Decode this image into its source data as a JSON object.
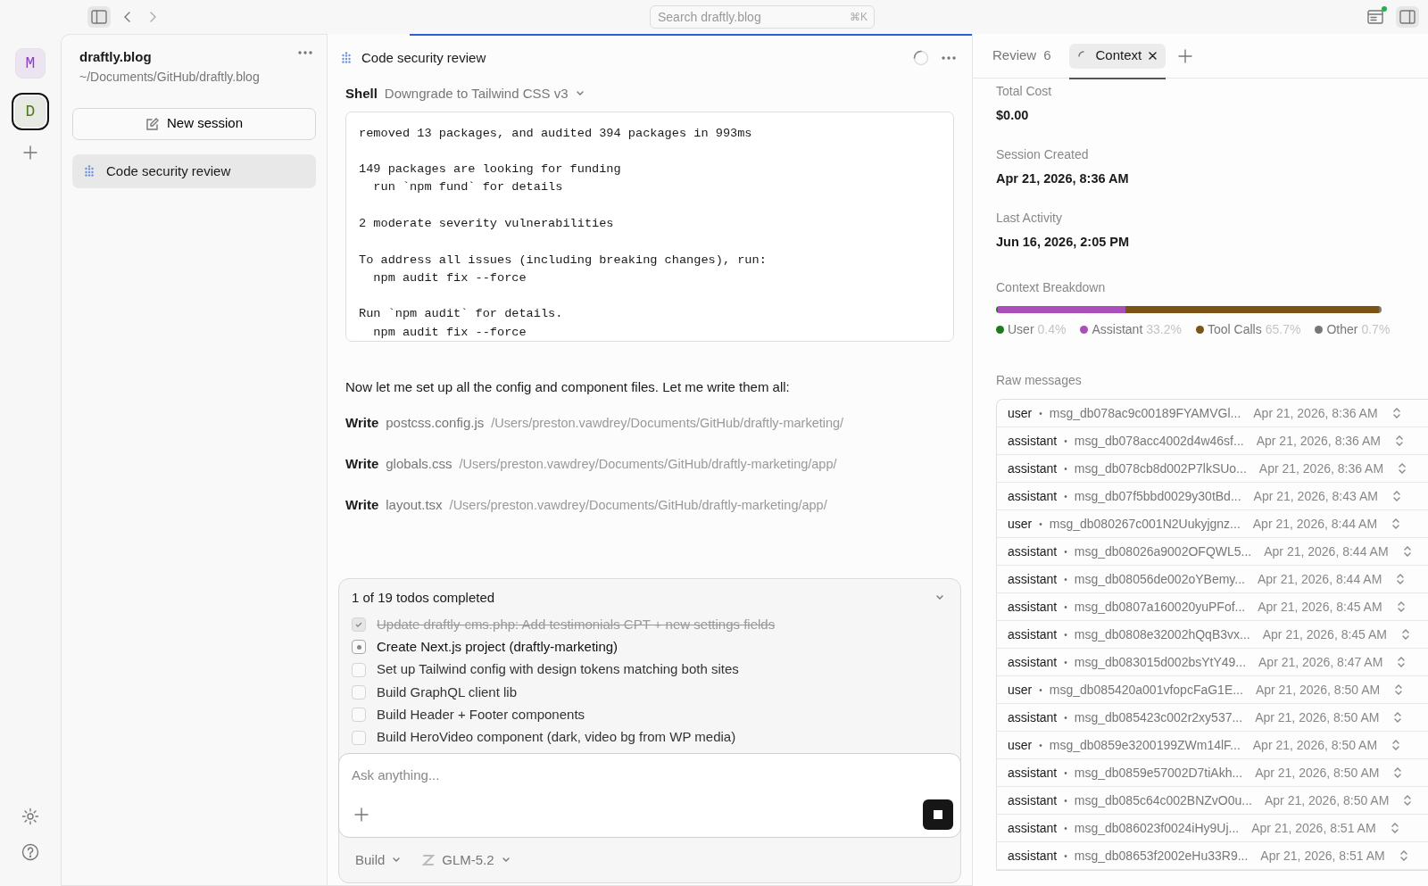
{
  "topbar": {
    "search": {
      "placeholder": "Search draftly.blog",
      "shortcut": "⌘K"
    },
    "notification": true
  },
  "rail": {
    "workspaces": [
      {
        "letter": "M",
        "color": "#8a3fc4",
        "selected": false
      },
      {
        "letter": "D",
        "color": "#4f7a1f",
        "selected": true
      }
    ]
  },
  "sidebar": {
    "project": "draftly.blog",
    "path": "~/Documents/GitHub/draftly.blog",
    "new_session": "New session",
    "sessions": [
      {
        "title": "Code security review",
        "selected": true
      }
    ]
  },
  "session": {
    "title": "Code security review",
    "shell": {
      "label": "Shell",
      "command": "Downgrade to Tailwind CSS v3",
      "output": [
        [
          "removed 13 packages, and audited 394 packages in 993ms"
        ],
        [
          "149 packages are looking for funding",
          "  run `npm fund` for details"
        ],
        [
          "2 moderate severity vulnerabilities"
        ],
        [
          "To address all issues (including breaking changes), run:",
          "  npm audit fix --force"
        ],
        [
          "Run `npm audit` for details.",
          "  npm audit fix --force"
        ]
      ]
    },
    "message": "Now let me set up all the config and component files. Let me write them all:",
    "writes": [
      {
        "label": "Write",
        "file": "postcss.config.js",
        "path": "/Users/preston.vawdrey/Documents/GitHub/draftly-marketing/"
      },
      {
        "label": "Write",
        "file": "globals.css",
        "path": "/Users/preston.vawdrey/Documents/GitHub/draftly-marketing/app/"
      },
      {
        "label": "Write",
        "file": "layout.tsx",
        "path": "/Users/preston.vawdrey/Documents/GitHub/draftly-marketing/app/"
      }
    ],
    "todos": {
      "summary": "1 of 19 todos completed",
      "items": [
        {
          "text": "Update draftly-cms.php: Add testimonials CPT + new settings fields",
          "checked": true,
          "in_progress": false
        },
        {
          "text": "Create Next.js project (draftly-marketing)",
          "checked": false,
          "in_progress": true
        },
        {
          "text": "Set up Tailwind config with design tokens matching both sites",
          "checked": false,
          "in_progress": false
        },
        {
          "text": "Build GraphQL client lib",
          "checked": false,
          "in_progress": false
        },
        {
          "text": "Build Header + Footer components",
          "checked": false,
          "in_progress": false
        },
        {
          "text": "Build HeroVideo component (dark, video bg from WP media)",
          "checked": false,
          "in_progress": false
        }
      ]
    },
    "composer": {
      "placeholder": "Ask anything..."
    },
    "agent": "Build",
    "model": "GLM-5.2"
  },
  "panel": {
    "tabs": [
      {
        "label": "Review",
        "count": "6",
        "selected": false
      },
      {
        "label": "Context",
        "selected": true
      }
    ],
    "fields": [
      {
        "label": "Total Cost",
        "value": "$0.00"
      },
      {
        "label": "Session Created",
        "value": "Apr 21, 2026, 8:36 AM"
      },
      {
        "label": "Last Activity",
        "value": "Jun 16, 2026, 2:05 PM"
      }
    ],
    "breakdown": {
      "title": "Context Breakdown",
      "parts": [
        {
          "label": "User",
          "percent": "0.4%",
          "level": 0.004,
          "color": "#1f7a1f"
        },
        {
          "label": "Assistant",
          "percent": "33.2%",
          "level": 0.332,
          "color": "#a94fb8"
        },
        {
          "label": "Tool Calls",
          "percent": "65.7%",
          "level": 0.657,
          "color": "#7d5417"
        },
        {
          "label": "Other",
          "percent": "0.7%",
          "level": 0.007,
          "color": "#777777"
        }
      ]
    },
    "raw_title": "Raw messages",
    "messages": [
      {
        "role": "user",
        "separator": "•",
        "id": "msg_db078ac9c00189FYAMVGl...",
        "time": "Apr 21, 2026, 8:36 AM"
      },
      {
        "role": "assistant",
        "separator": "•",
        "id": "msg_db078acc4002d4w46sf...",
        "time": "Apr 21, 2026, 8:36 AM"
      },
      {
        "role": "assistant",
        "separator": "•",
        "id": "msg_db078cb8d002P7lkSUo...",
        "time": "Apr 21, 2026, 8:36 AM"
      },
      {
        "role": "assistant",
        "separator": "•",
        "id": "msg_db07f5bbd0029y30tBd...",
        "time": "Apr 21, 2026, 8:43 AM"
      },
      {
        "role": "user",
        "separator": "•",
        "id": "msg_db080267c001N2Uukyjgnz...",
        "time": "Apr 21, 2026, 8:44 AM"
      },
      {
        "role": "assistant",
        "separator": "•",
        "id": "msg_db08026a9002OFQWL5...",
        "time": "Apr 21, 2026, 8:44 AM"
      },
      {
        "role": "assistant",
        "separator": "•",
        "id": "msg_db08056de002oYBemy...",
        "time": "Apr 21, 2026, 8:44 AM"
      },
      {
        "role": "assistant",
        "separator": "•",
        "id": "msg_db0807a160020yuPFof...",
        "time": "Apr 21, 2026, 8:45 AM"
      },
      {
        "role": "assistant",
        "separator": "•",
        "id": "msg_db0808e32002hQqB3vx...",
        "time": "Apr 21, 2026, 8:45 AM"
      },
      {
        "role": "assistant",
        "separator": "•",
        "id": "msg_db083015d002bsYtY49...",
        "time": "Apr 21, 2026, 8:47 AM"
      },
      {
        "role": "user",
        "separator": "•",
        "id": "msg_db085420a001vfopcFaG1E...",
        "time": "Apr 21, 2026, 8:50 AM"
      },
      {
        "role": "assistant",
        "separator": "•",
        "id": "msg_db085423c002r2xy537...",
        "time": "Apr 21, 2026, 8:50 AM"
      },
      {
        "role": "user",
        "separator": "•",
        "id": "msg_db0859e3200199ZWm14lF...",
        "time": "Apr 21, 2026, 8:50 AM"
      },
      {
        "role": "assistant",
        "separator": "•",
        "id": "msg_db0859e57002D7tiAkh...",
        "time": "Apr 21, 2026, 8:50 AM"
      },
      {
        "role": "assistant",
        "separator": "•",
        "id": "msg_db085c64c002BNZvO0u...",
        "time": "Apr 21, 2026, 8:50 AM"
      },
      {
        "role": "assistant",
        "separator": "•",
        "id": "msg_db086023f0024iHy9Uj...",
        "time": "Apr 21, 2026, 8:51 AM"
      },
      {
        "role": "assistant",
        "separator": "•",
        "id": "msg_db08653f2002eHu33R9...",
        "time": "Apr 21, 2026, 8:51 AM"
      }
    ]
  }
}
